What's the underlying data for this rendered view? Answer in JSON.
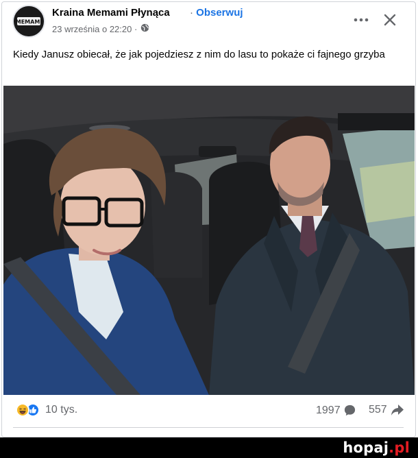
{
  "post": {
    "page_name": "Kraina Memami Płynąca",
    "separator": "·",
    "follow_label": "Obserwuj",
    "timestamp": "23 września o 22:20 ·",
    "avatar_text": "MEMAMI",
    "caption": "Kiedy Janusz obiecał, że jak pojedziesz z nim do lasu to pokaże ci fajnego grzyba"
  },
  "icons": {
    "audience": "globe-icon",
    "more": "more-icon",
    "close": "close-icon",
    "haha": "haha-reaction-icon",
    "like": "like-reaction-icon",
    "comment": "comment-icon",
    "share": "share-icon"
  },
  "stats": {
    "reactions": "10 tys.",
    "comments": "1997",
    "shares": "557"
  },
  "watermark": {
    "brand": "hopaj",
    "tld": "pl"
  },
  "colors": {
    "link": "#1b74e4",
    "secondary_text": "#65676b",
    "like_blue": "#1877f2",
    "haha_yellow": "#f7b928",
    "watermark_red": "#e31c23"
  }
}
